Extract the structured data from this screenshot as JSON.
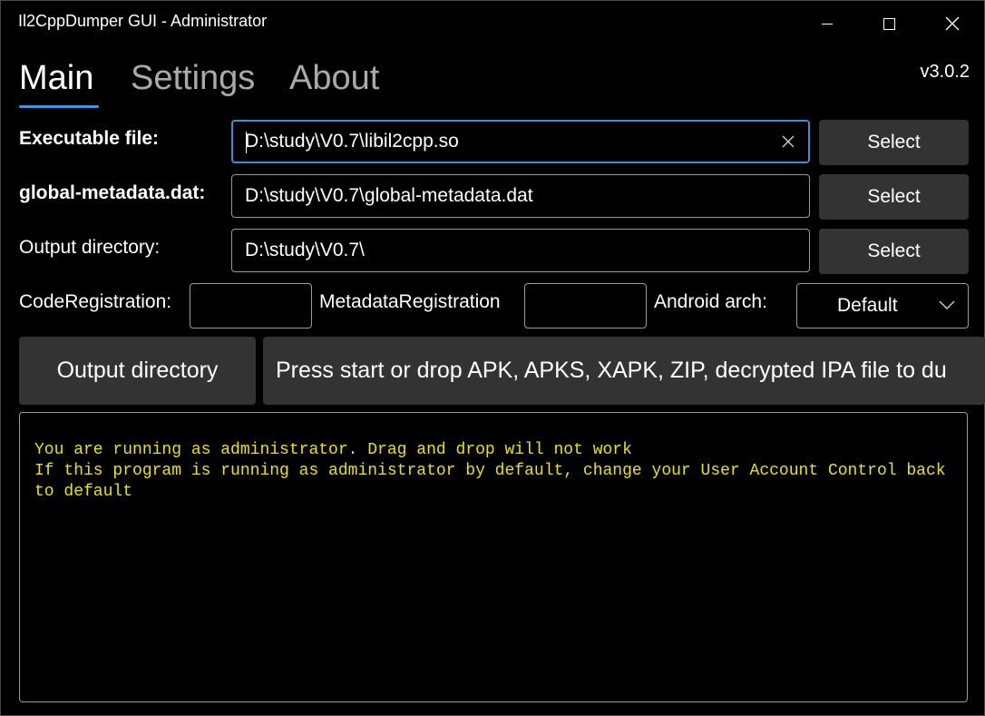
{
  "window": {
    "title": "Il2CppDumper GUI - Administrator"
  },
  "tabs": [
    {
      "label": "Main",
      "active": true
    },
    {
      "label": "Settings",
      "active": false
    },
    {
      "label": "About",
      "active": false
    }
  ],
  "version": "v3.0.2",
  "accent_color": "#3a97e0",
  "form": {
    "executable": {
      "label": "Executable file:",
      "value": "D:\\study\\V0.7\\libil2cpp.so",
      "button": "Select"
    },
    "metadata": {
      "label": "global-metadata.dat:",
      "value": "D:\\study\\V0.7\\global-metadata.dat",
      "button": "Select"
    },
    "output": {
      "label": "Output directory:",
      "value": "D:\\study\\V0.7\\",
      "button": "Select"
    },
    "code_registration": {
      "label": "CodeRegistration:",
      "value": ""
    },
    "metadata_registration": {
      "label": "MetadataRegistration",
      "value": ""
    },
    "android_arch": {
      "label": "Android arch:",
      "value": "Default"
    }
  },
  "actions": {
    "output_directory": "Output directory",
    "start": "Press start or drop APK, APKS, XAPK, ZIP, decrypted IPA file to du"
  },
  "console": {
    "color": "#e9e400",
    "lines": [
      "You are running as administrator. Drag and drop will not work",
      "If this program is running as administrator by default, change your User Account Control back to default"
    ]
  },
  "icons": {
    "minimize": "minimize-icon",
    "maximize": "maximize-icon",
    "close": "close-icon",
    "clear": "clear-icon",
    "dropdown": "chevron-down-icon"
  }
}
